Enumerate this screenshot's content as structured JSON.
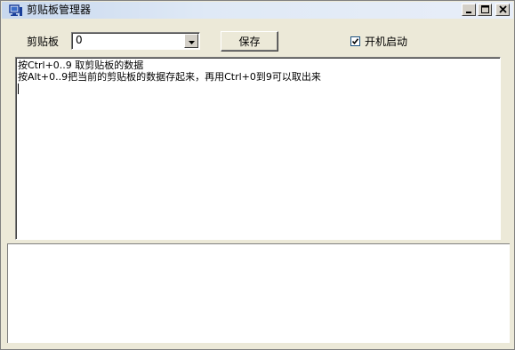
{
  "window": {
    "title": "剪贴板管理器",
    "icon": "monitor-icon"
  },
  "title_buttons": {
    "minimize_icon": "minimize-icon",
    "maximize_icon": "maximize-icon",
    "close_icon": "close-icon"
  },
  "toolbar": {
    "clipboard_label": "剪贴板",
    "clipboard_select_value": "0",
    "save_label": "保存",
    "autostart_label": "开机启动",
    "autostart_checked": true
  },
  "editor": {
    "lines": [
      "按Ctrl+0..9 取剪贴板的数据",
      "按Alt+0..9把当前的剪贴板的数据存起来，再用Ctrl+0到9可以取出来"
    ]
  },
  "colors": {
    "face": "#ece9d8",
    "titlebar": "#dfe9f6",
    "checkbox_border": "#1c5180"
  }
}
